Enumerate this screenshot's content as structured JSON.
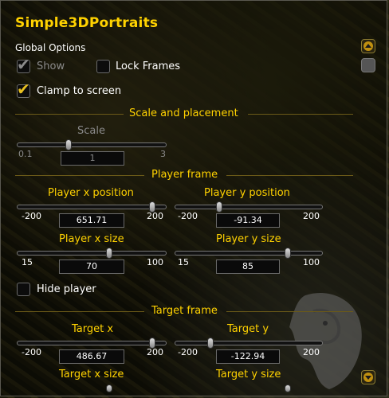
{
  "title": "Simple3DPortraits",
  "global": {
    "label": "Global Options",
    "show_label": "Show",
    "show_checked": true,
    "lock_label": "Lock Frames",
    "lock_checked": false,
    "clamp_label": "Clamp to screen",
    "clamp_checked": true
  },
  "scale_section": {
    "header": "Scale and placement",
    "scale": {
      "label": "Scale",
      "min": "0.1",
      "max": "3",
      "value": "1"
    }
  },
  "player_section": {
    "header": "Player frame",
    "x_pos": {
      "label": "Player x position",
      "min": "-200",
      "max": "200",
      "value": "651.71"
    },
    "y_pos": {
      "label": "Player y position",
      "min": "-200",
      "max": "200",
      "value": "-91.34"
    },
    "x_size": {
      "label": "Player x size",
      "min": "15",
      "max": "100",
      "value": "70"
    },
    "y_size": {
      "label": "Player y size",
      "min": "15",
      "max": "100",
      "value": "85"
    },
    "hide_label": "Hide player",
    "hide_checked": false
  },
  "target_section": {
    "header": "Target frame",
    "x": {
      "label": "Target x",
      "min": "-200",
      "max": "200",
      "value": "486.67"
    },
    "y": {
      "label": "Target y",
      "min": "-200",
      "max": "200",
      "value": "-122.94"
    },
    "x_size": {
      "label": "Target x size"
    },
    "y_size": {
      "label": "Target y size"
    }
  },
  "icons": {
    "scroll_up": "scroll-up-icon",
    "scroll_down": "scroll-down-icon",
    "lion": "lion-emblem-icon"
  },
  "colors": {
    "gold": "#ffd200",
    "text": "#ffffff",
    "disabled": "#8a8a8a"
  }
}
